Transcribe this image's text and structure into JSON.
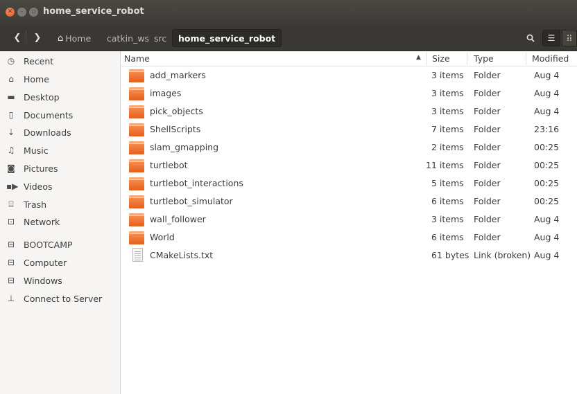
{
  "window": {
    "title": "home_service_robot"
  },
  "pathbar": {
    "crumbs": [
      {
        "label": "Home"
      },
      {
        "label": "catkin_ws"
      },
      {
        "label": "src"
      },
      {
        "label": "home_service_robot"
      }
    ]
  },
  "sidebar": {
    "items": [
      {
        "label": "Recent",
        "icon": "clock-icon"
      },
      {
        "label": "Home",
        "icon": "home-icon"
      },
      {
        "label": "Desktop",
        "icon": "desktop-folder-icon"
      },
      {
        "label": "Documents",
        "icon": "document-icon"
      },
      {
        "label": "Downloads",
        "icon": "download-icon"
      },
      {
        "label": "Music",
        "icon": "music-icon"
      },
      {
        "label": "Pictures",
        "icon": "camera-icon"
      },
      {
        "label": "Videos",
        "icon": "video-icon"
      },
      {
        "label": "Trash",
        "icon": "trash-icon"
      },
      {
        "label": "Network",
        "icon": "network-icon"
      },
      {
        "label": "BOOTCAMP",
        "icon": "drive-icon"
      },
      {
        "label": "Computer",
        "icon": "drive-icon"
      },
      {
        "label": "Windows",
        "icon": "drive-icon"
      },
      {
        "label": "Connect to Server",
        "icon": "server-icon"
      }
    ]
  },
  "columns": {
    "name": "Name",
    "size": "Size",
    "type": "Type",
    "modified": "Modified"
  },
  "files": [
    {
      "name": "add_markers",
      "size": "3 items",
      "type": "Folder",
      "modified": "Aug 4",
      "kind": "folder"
    },
    {
      "name": "images",
      "size": "3 items",
      "type": "Folder",
      "modified": "Aug 4",
      "kind": "folder"
    },
    {
      "name": "pick_objects",
      "size": "3 items",
      "type": "Folder",
      "modified": "Aug 4",
      "kind": "folder"
    },
    {
      "name": "ShellScripts",
      "size": "7 items",
      "type": "Folder",
      "modified": "23:16",
      "kind": "folder"
    },
    {
      "name": "slam_gmapping",
      "size": "2 items",
      "type": "Folder",
      "modified": "00:25",
      "kind": "folder"
    },
    {
      "name": "turtlebot",
      "size": "11 items",
      "type": "Folder",
      "modified": "00:25",
      "kind": "folder"
    },
    {
      "name": "turtlebot_interactions",
      "size": "5 items",
      "type": "Folder",
      "modified": "00:25",
      "kind": "folder"
    },
    {
      "name": "turtlebot_simulator",
      "size": "6 items",
      "type": "Folder",
      "modified": "00:25",
      "kind": "folder"
    },
    {
      "name": "wall_follower",
      "size": "3 items",
      "type": "Folder",
      "modified": "Aug 4",
      "kind": "folder"
    },
    {
      "name": "World",
      "size": "6 items",
      "type": "Folder",
      "modified": "Aug 4",
      "kind": "folder"
    },
    {
      "name": "CMakeLists.txt",
      "size": "61 bytes",
      "type": "Link (broken)",
      "modified": "Aug 4",
      "kind": "file"
    }
  ]
}
